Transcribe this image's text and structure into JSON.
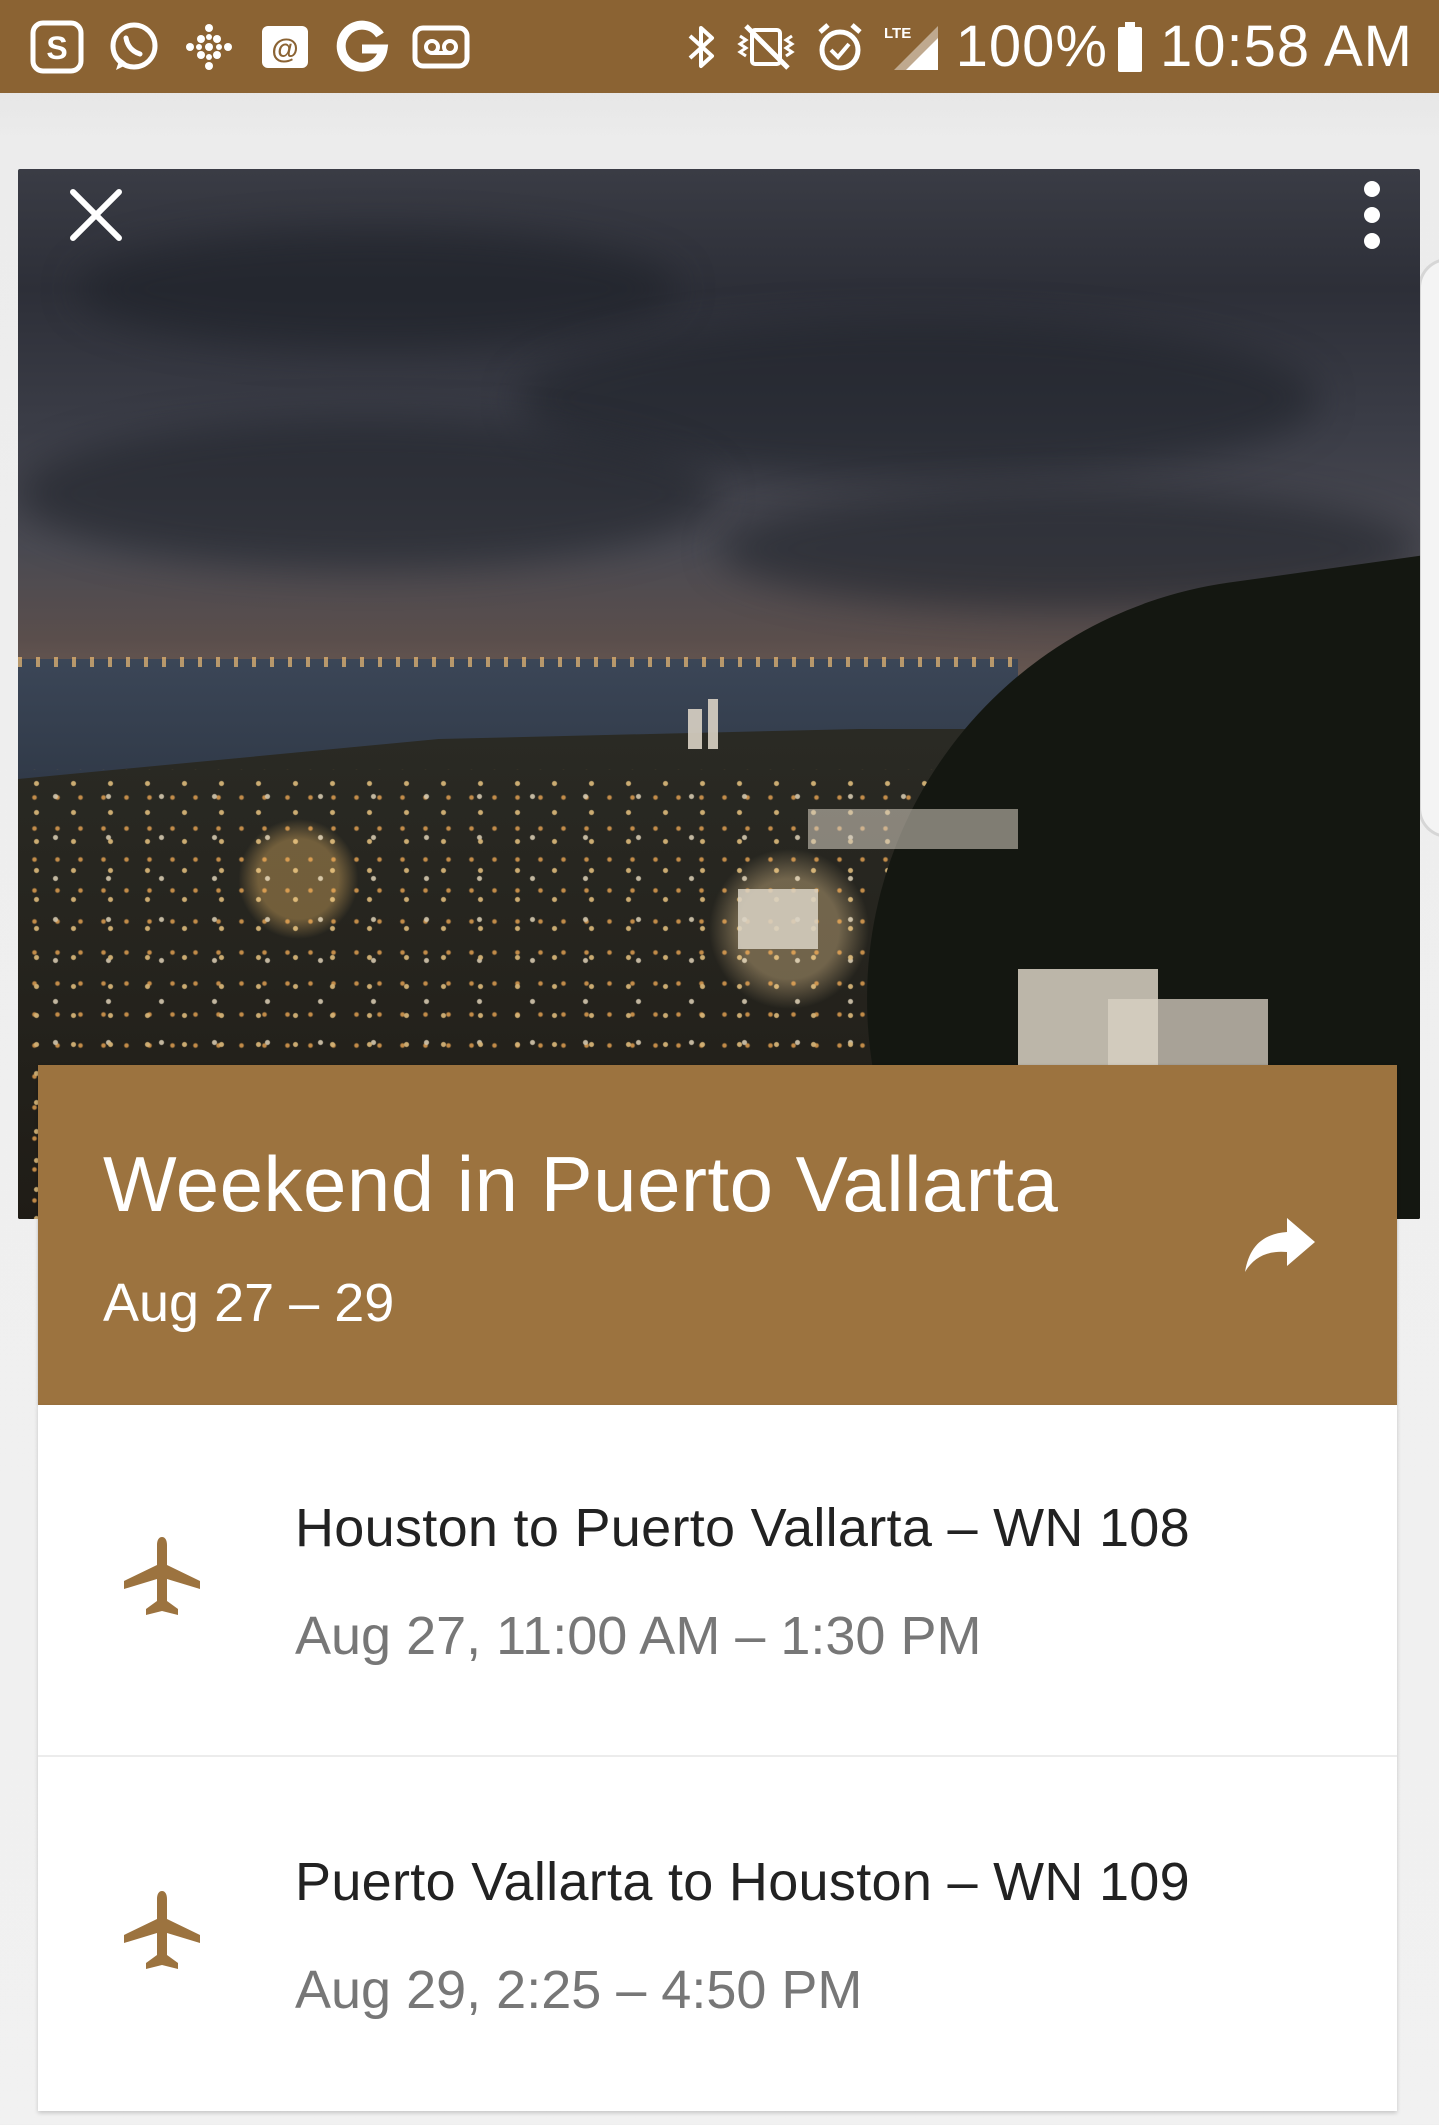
{
  "status_bar": {
    "left_icons": [
      "skype-icon",
      "whatsapp-icon",
      "slack-icon",
      "email-icon",
      "google-icon",
      "voicemail-icon"
    ],
    "right_icons": [
      "bluetooth-icon",
      "mute-vibrate-icon",
      "alarm-icon",
      "lte-signal-icon"
    ],
    "lte_label": "LTE",
    "battery": "100%",
    "time": "10:58 AM"
  },
  "trip": {
    "title": "Weekend in Puerto Vallarta",
    "dates": "Aug 27 – 29",
    "accent_color": "#9c733f"
  },
  "flights": [
    {
      "route": "Houston to Puerto Vallarta – WN 108",
      "time": "Aug 27, 11:00 AM – 1:30 PM"
    },
    {
      "route": "Puerto Vallarta to Houston – WN 109",
      "time": "Aug 29, 2:25 – 4:50 PM"
    }
  ],
  "colors": {
    "status_bar": "#8b6333",
    "header_band": "#9c733f",
    "plane_icon": "#9c733f",
    "route_text": "#222222",
    "time_text": "#777777"
  }
}
